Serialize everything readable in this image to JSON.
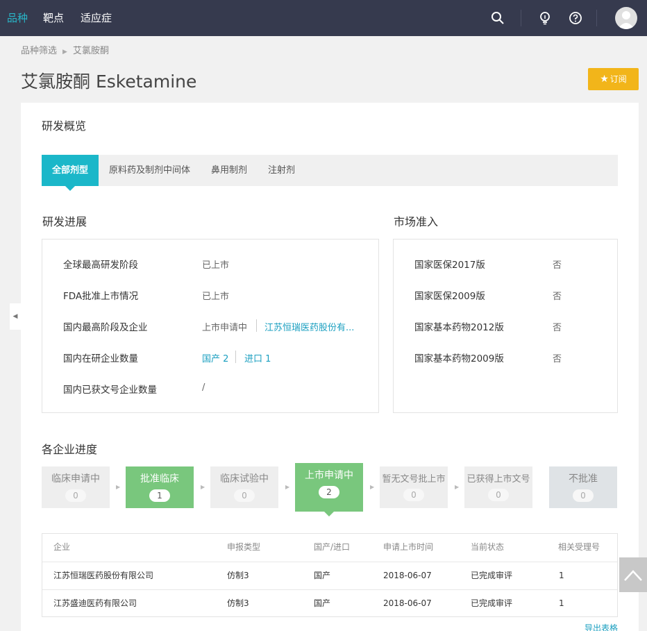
{
  "topnav": {
    "items": [
      "品种",
      "靶点",
      "适应症"
    ],
    "icons": [
      "search-icon",
      "bulb-icon",
      "help-icon",
      "avatar"
    ]
  },
  "breadcrumb": [
    "品种筛选",
    "艾氯胺酮"
  ],
  "page": {
    "title": "艾氯胺酮 Esketamine",
    "subscribe_label": "订阅"
  },
  "overview": {
    "title": "研发概览",
    "tabs": [
      "全部剂型",
      "原料药及制剂中间体",
      "鼻用制剂",
      "注射剂"
    ]
  },
  "progress": {
    "title": "研发进展",
    "rows": [
      {
        "label": "全球最高研发阶段",
        "value": "已上市"
      },
      {
        "label": "FDA批准上市情况",
        "value": "已上市"
      },
      {
        "label": "国内最高阶段及企业",
        "value": "上市申请中",
        "company": "江苏恒瑞医药股份有..."
      },
      {
        "label": "国内在研企业数量",
        "domestic": "国产 2",
        "import": "进口 1"
      },
      {
        "label": "国内已获文号企业数量",
        "value": "/"
      }
    ]
  },
  "market": {
    "title": "市场准入",
    "rows": [
      {
        "label": "国家医保2017版",
        "value": "否"
      },
      {
        "label": "国家医保2009版",
        "value": "否"
      },
      {
        "label": "国家基本药物2012版",
        "value": "否"
      },
      {
        "label": "国家基本药物2009版",
        "value": "否"
      }
    ]
  },
  "stages": {
    "title": "各企业进度",
    "items": [
      {
        "label": "临床申请中",
        "count": "0"
      },
      {
        "label": "批准临床",
        "count": "1"
      },
      {
        "label": "临床试验中",
        "count": "0"
      },
      {
        "label": "上市申请中",
        "count": "2"
      },
      {
        "label": "暂无文号批上市",
        "count": "0"
      },
      {
        "label": "已获得上市文号",
        "count": "0"
      },
      {
        "label": "不批准",
        "count": "0"
      }
    ]
  },
  "table": {
    "headers": [
      "企业",
      "申报类型",
      "国产/进口",
      "申请上市时间",
      "当前状态",
      "相关受理号"
    ],
    "rows": [
      [
        "江苏恒瑞医药股份有限公司",
        "仿制3",
        "国产",
        "2018-06-07",
        "已完成审评",
        "1"
      ],
      [
        "江苏盛迪医药有限公司",
        "仿制3",
        "国产",
        "2018-06-07",
        "已完成审评",
        "1"
      ]
    ],
    "export_label": "导出表格"
  },
  "colors": {
    "topbar": "#363a4e",
    "accent": "#1bb7c9",
    "subscribe": "#f2b51a",
    "stage_active": "#79c77d",
    "link": "#1a9fc0"
  }
}
